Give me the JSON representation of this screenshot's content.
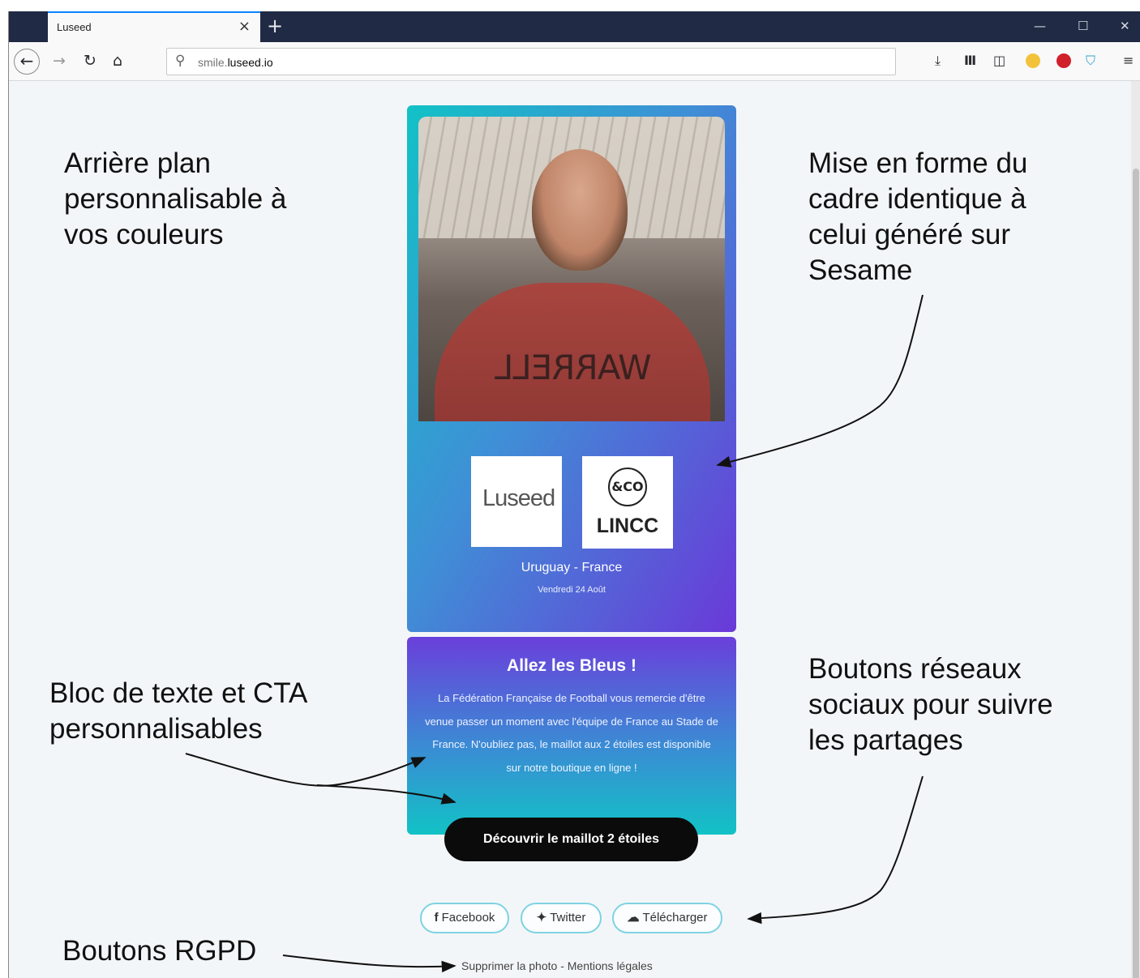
{
  "browser": {
    "tab_title": "Luseed",
    "tab_close": "×",
    "new_tab": "+",
    "url_prefix": "smile.",
    "url_domain": "luseed.io"
  },
  "annotations": {
    "background": "Arrière plan\npersonnalisable à\nvos couleurs",
    "frame": "Mise en forme du\ncadre identique à\ncelui généré sur\nSesame",
    "text_block": "Bloc de texte et CTA\npersonnalisables",
    "social": "Boutons réseaux\nsociaux pour suivre\nles partages",
    "gdpr": "Boutons RGPD"
  },
  "card": {
    "photo_shirt_text": "WARRELL",
    "logo_luseed": "Luseed",
    "logo_lincc_ring": "&CO",
    "logo_lincc": "LINCC",
    "match": "Uruguay - France",
    "date": "Vendredi 24 Août"
  },
  "text_block": {
    "title": "Allez les Bleus !",
    "body": "La Fédération Française de Football vous remercie d'être venue passer un moment avec l'équipe de France au Stade de France. N'oubliez pas, le maillot aux 2 étoiles est disponible sur notre boutique en ligne !",
    "cta": "Découvrir le maillot 2 étoiles"
  },
  "social": {
    "facebook": "Facebook",
    "twitter": "Twitter",
    "download": "Télécharger"
  },
  "legal": {
    "delete_photo": "Supprimer la photo",
    "separator": "-",
    "legal_notice": "Mentions légales"
  },
  "colors": {
    "gradient_teal": "#12c2c6",
    "gradient_purple": "#6a39d8",
    "cta_bg": "#0b0b0b",
    "social_border": "#7fd3e2"
  }
}
